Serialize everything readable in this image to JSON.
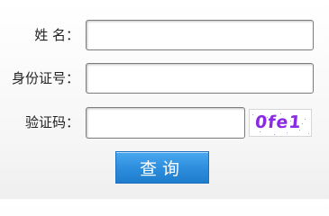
{
  "form": {
    "name_label": "姓  名：",
    "name_value": "",
    "id_label": "身份证号：",
    "id_value": "",
    "captcha_label": "验证码：",
    "captcha_value": "",
    "captcha_image_text": "0fe1",
    "submit_label": "查询"
  },
  "colors": {
    "submit_background": "#2f8fdf",
    "captcha_text": "#8a2be2",
    "input_border": "#7d7d7d"
  }
}
